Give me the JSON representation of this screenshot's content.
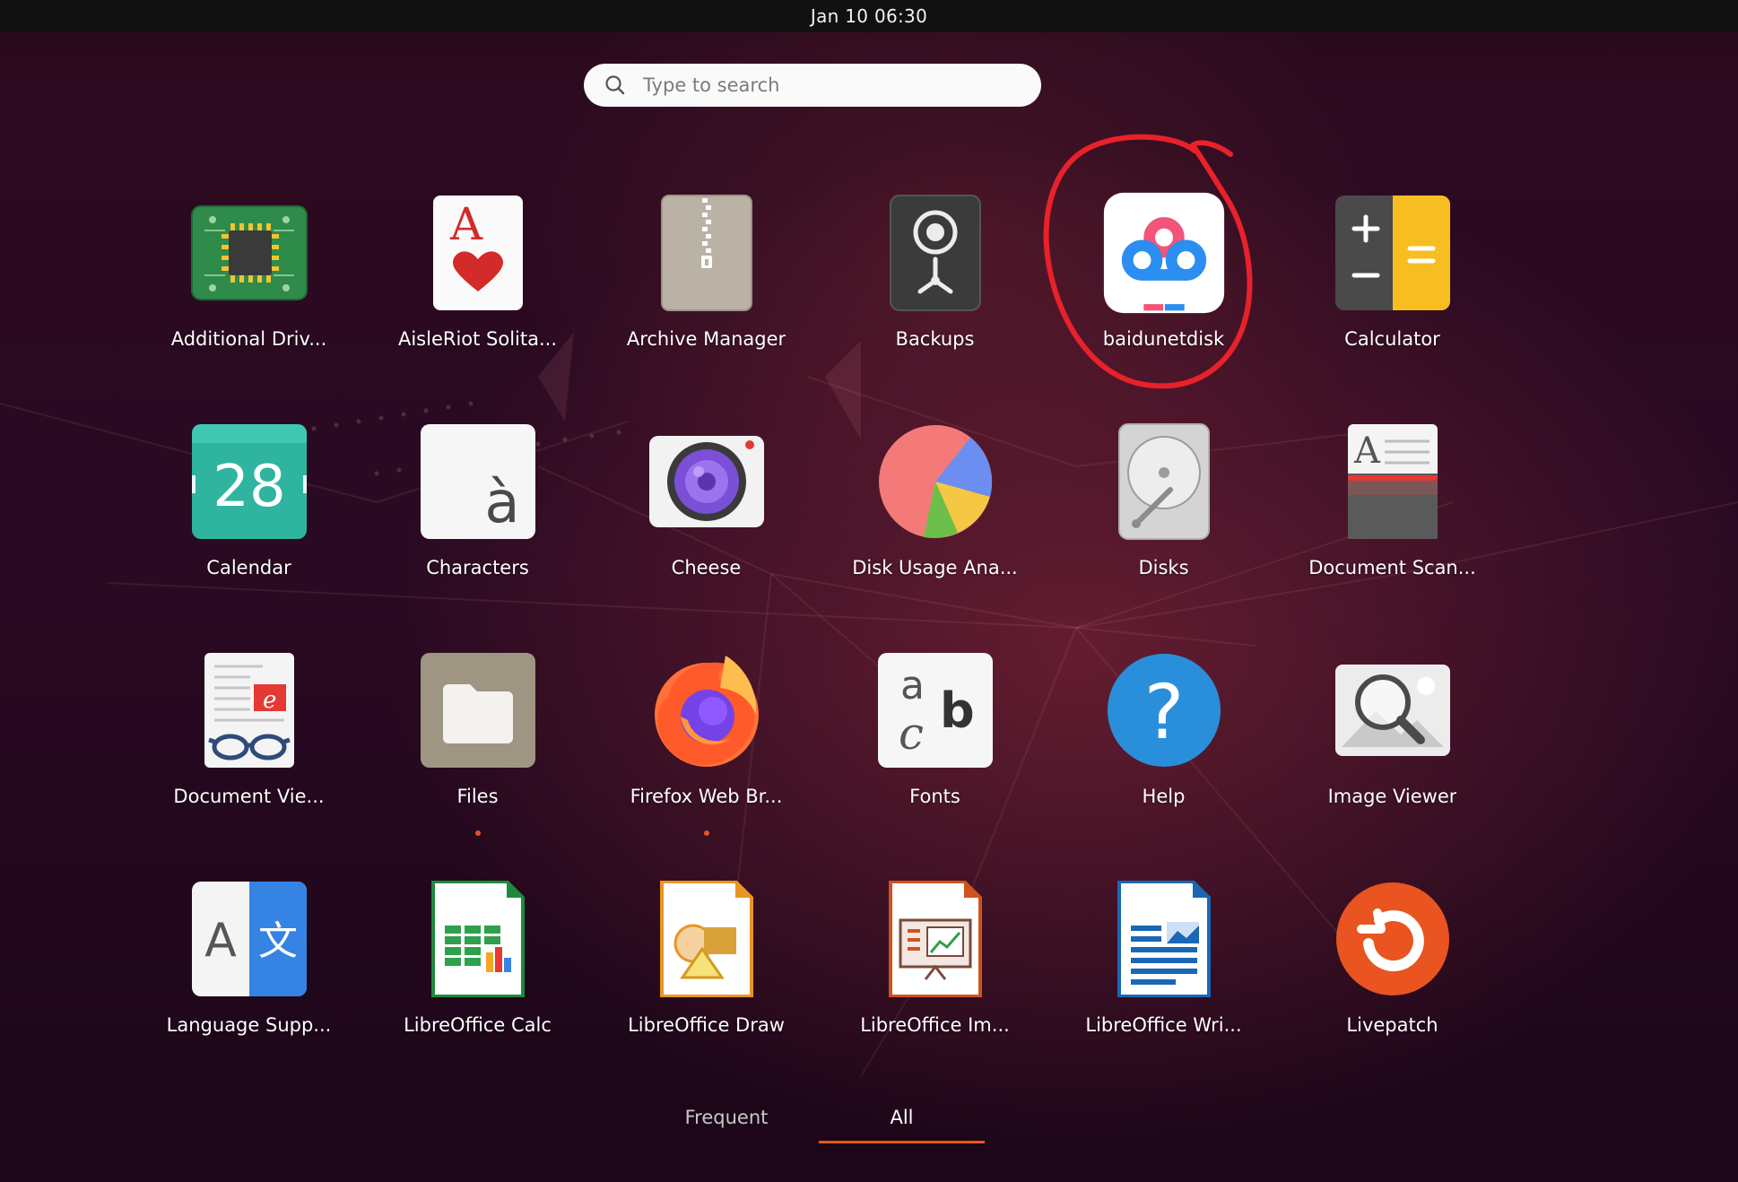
{
  "topbar": {
    "datetime": "Jan 10  06:30"
  },
  "search": {
    "placeholder": "Type to search",
    "icon": "search-icon"
  },
  "apps": [
    {
      "label": "Additional Driv...",
      "icon": "chip-icon",
      "running": false
    },
    {
      "label": "AisleRiot Solita...",
      "icon": "playing-card-icon",
      "running": false
    },
    {
      "label": "Archive Manager",
      "icon": "archive-zip-icon",
      "running": false
    },
    {
      "label": "Backups",
      "icon": "safe-icon",
      "running": false
    },
    {
      "label": "baidunetdisk",
      "icon": "baidu-cloud-icon",
      "running": false,
      "annotated": true
    },
    {
      "label": "Calculator",
      "icon": "calculator-icon",
      "running": false
    },
    {
      "label": "Calendar",
      "icon": "calendar-icon",
      "running": false,
      "day": "28"
    },
    {
      "label": "Characters",
      "icon": "characters-icon",
      "running": false,
      "glyph": "à"
    },
    {
      "label": "Cheese",
      "icon": "camera-icon",
      "running": false
    },
    {
      "label": "Disk Usage Ana...",
      "icon": "pie-chart-icon",
      "running": false
    },
    {
      "label": "Disks",
      "icon": "hard-disk-icon",
      "running": false
    },
    {
      "label": "Document Scan...",
      "icon": "scanner-icon",
      "running": false
    },
    {
      "label": "Document Vie...",
      "icon": "document-viewer-icon",
      "running": false
    },
    {
      "label": "Files",
      "icon": "folder-icon",
      "running": true
    },
    {
      "label": "Firefox Web Br...",
      "icon": "firefox-icon",
      "running": true
    },
    {
      "label": "Fonts",
      "icon": "fonts-icon",
      "running": false
    },
    {
      "label": "Help",
      "icon": "help-icon",
      "running": false
    },
    {
      "label": "Image Viewer",
      "icon": "image-viewer-icon",
      "running": false
    },
    {
      "label": "Language Supp...",
      "icon": "language-icon",
      "running": false
    },
    {
      "label": "LibreOffice Calc",
      "icon": "libreoffice-calc-icon",
      "running": false
    },
    {
      "label": "LibreOffice Draw",
      "icon": "libreoffice-draw-icon",
      "running": false
    },
    {
      "label": "LibreOffice Im...",
      "icon": "libreoffice-impress-icon",
      "running": false
    },
    {
      "label": "LibreOffice Wri...",
      "icon": "libreoffice-writer-icon",
      "running": false
    },
    {
      "label": "Livepatch",
      "icon": "livepatch-icon",
      "running": false
    }
  ],
  "tabs": {
    "frequent": "Frequent",
    "all": "All",
    "active": "All"
  },
  "colors": {
    "accent": "#e95420",
    "annotation": "#e8212a"
  }
}
